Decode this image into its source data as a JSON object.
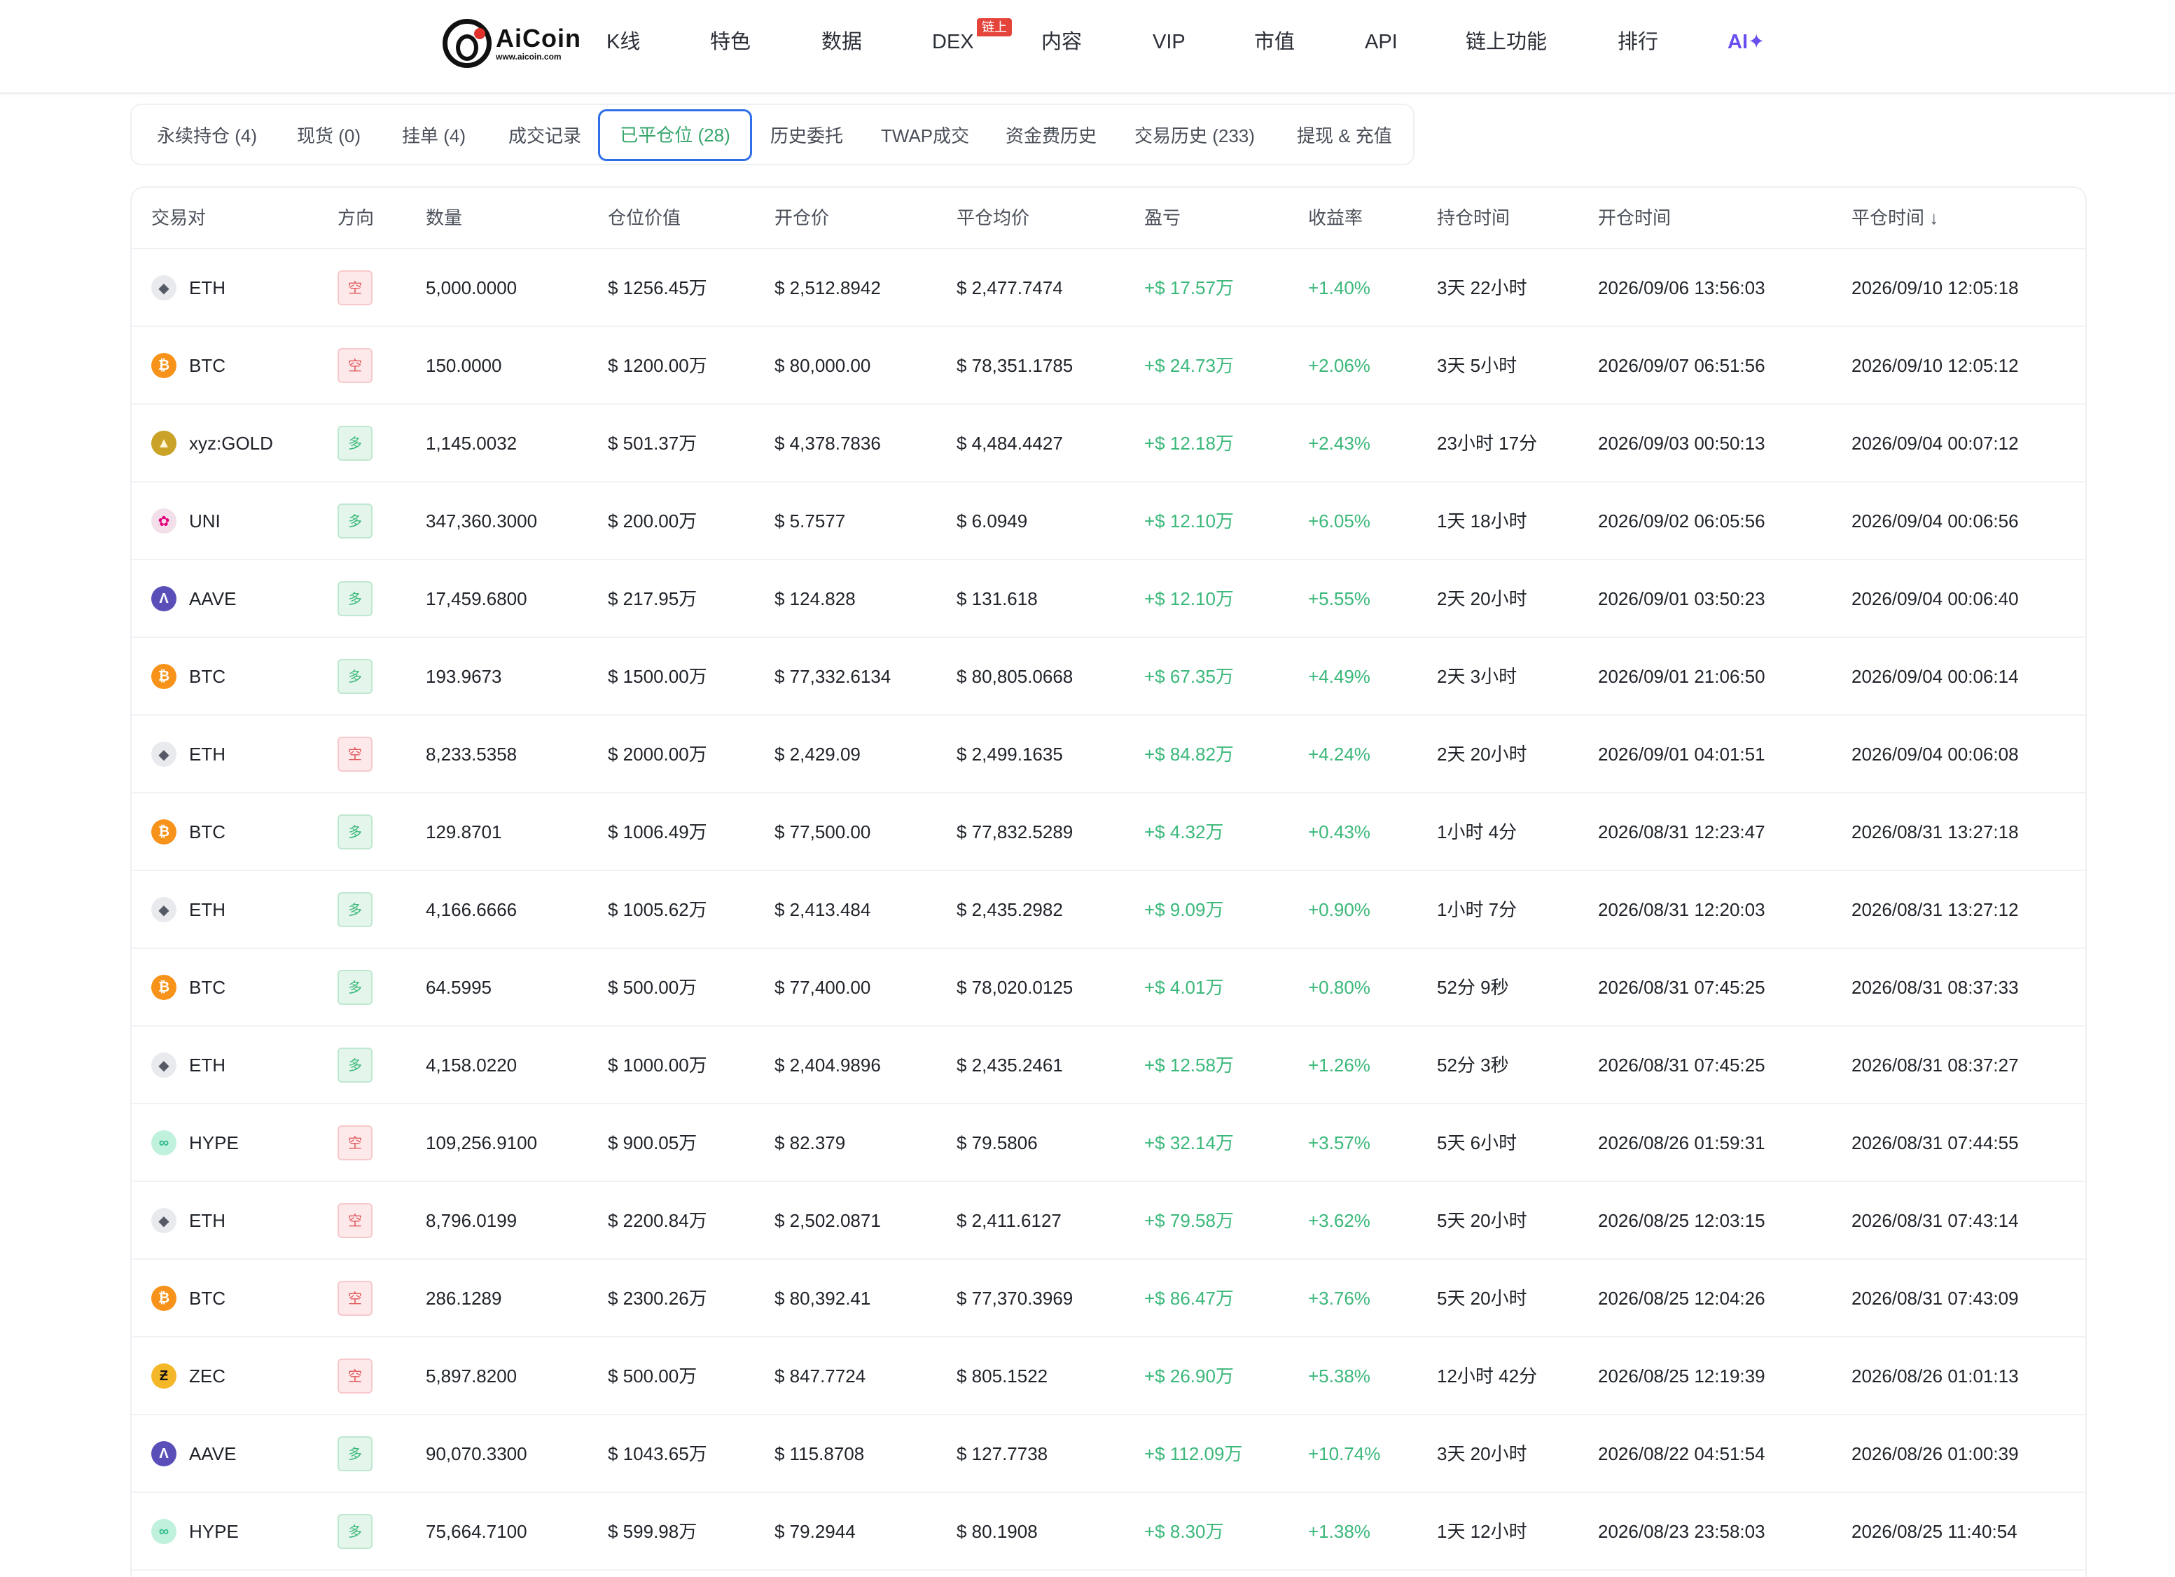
{
  "nav": {
    "logo_name": "AiCoin",
    "logo_url": "www.aicoin.com",
    "items": [
      "K线",
      "特色",
      "数据",
      "DEX",
      "内容",
      "VIP",
      "市值",
      "API",
      "链上功能",
      "排行",
      "AI✦"
    ],
    "dex_badge": "链上"
  },
  "tabs": [
    {
      "label": "永续持仓 (4)"
    },
    {
      "label": "现货 (0)"
    },
    {
      "label": "挂单 (4)"
    },
    {
      "label": "成交记录"
    },
    {
      "label": "已平仓位 (28)",
      "active": true
    },
    {
      "label": "历史委托"
    },
    {
      "label": "TWAP成交"
    },
    {
      "label": "资金费历史"
    },
    {
      "label": "交易历史 (233)"
    },
    {
      "label": "提现 & 充值"
    }
  ],
  "columns": [
    "交易对",
    "方向",
    "数量",
    "仓位价值",
    "开仓价",
    "平仓均价",
    "盈亏",
    "收益率",
    "持仓时间",
    "开仓时间",
    "平仓时间 ↓"
  ],
  "colors": {
    "profit": "#3bb87a",
    "short_bg": "#fde9ea",
    "long_bg": "#e4f6ec",
    "active_tab_border": "#2f6ee8"
  },
  "rows": [
    {
      "icon": "eth-icon",
      "pair": "ETH",
      "dir": "空",
      "qty": "5,000.0000",
      "value": "$ 1256.45万",
      "open": "$ 2,512.8942",
      "close": "$ 2,477.7474",
      "pnl": "+$ 17.57万",
      "roi": "+1.40%",
      "hold": "3天 22小时",
      "open_time": "2026/09/06 13:56:03",
      "close_time": "2026/09/10 12:05:18"
    },
    {
      "icon": "btc-icon",
      "pair": "BTC",
      "dir": "空",
      "qty": "150.0000",
      "value": "$ 1200.00万",
      "open": "$ 80,000.00",
      "close": "$ 78,351.1785",
      "pnl": "+$ 24.73万",
      "roi": "+2.06%",
      "hold": "3天 5小时",
      "open_time": "2026/09/07 06:51:56",
      "close_time": "2026/09/10 12:05:12"
    },
    {
      "icon": "gold-icon",
      "pair": "xyz:GOLD",
      "dir": "多",
      "qty": "1,145.0032",
      "value": "$ 501.37万",
      "open": "$ 4,378.7836",
      "close": "$ 4,484.4427",
      "pnl": "+$ 12.18万",
      "roi": "+2.43%",
      "hold": "23小时 17分",
      "open_time": "2026/09/03 00:50:13",
      "close_time": "2026/09/04 00:07:12"
    },
    {
      "icon": "uni-icon",
      "pair": "UNI",
      "dir": "多",
      "qty": "347,360.3000",
      "value": "$ 200.00万",
      "open": "$ 5.7577",
      "close": "$ 6.0949",
      "pnl": "+$ 12.10万",
      "roi": "+6.05%",
      "hold": "1天 18小时",
      "open_time": "2026/09/02 06:05:56",
      "close_time": "2026/09/04 00:06:56"
    },
    {
      "icon": "aave-icon",
      "pair": "AAVE",
      "dir": "多",
      "qty": "17,459.6800",
      "value": "$ 217.95万",
      "open": "$ 124.828",
      "close": "$ 131.618",
      "pnl": "+$ 12.10万",
      "roi": "+5.55%",
      "hold": "2天 20小时",
      "open_time": "2026/09/01 03:50:23",
      "close_time": "2026/09/04 00:06:40"
    },
    {
      "icon": "btc-icon",
      "pair": "BTC",
      "dir": "多",
      "qty": "193.9673",
      "value": "$ 1500.00万",
      "open": "$ 77,332.6134",
      "close": "$ 80,805.0668",
      "pnl": "+$ 67.35万",
      "roi": "+4.49%",
      "hold": "2天 3小时",
      "open_time": "2026/09/01 21:06:50",
      "close_time": "2026/09/04 00:06:14"
    },
    {
      "icon": "eth-icon",
      "pair": "ETH",
      "dir": "空",
      "qty": "8,233.5358",
      "value": "$ 2000.00万",
      "open": "$ 2,429.09",
      "close": "$ 2,499.1635",
      "pnl": "+$ 84.82万",
      "roi": "+4.24%",
      "hold": "2天 20小时",
      "open_time": "2026/09/01 04:01:51",
      "close_time": "2026/09/04 00:06:08"
    },
    {
      "icon": "btc-icon",
      "pair": "BTC",
      "dir": "多",
      "qty": "129.8701",
      "value": "$ 1006.49万",
      "open": "$ 77,500.00",
      "close": "$ 77,832.5289",
      "pnl": "+$ 4.32万",
      "roi": "+0.43%",
      "hold": "1小时 4分",
      "open_time": "2026/08/31 12:23:47",
      "close_time": "2026/08/31 13:27:18"
    },
    {
      "icon": "eth-icon",
      "pair": "ETH",
      "dir": "多",
      "qty": "4,166.6666",
      "value": "$ 1005.62万",
      "open": "$ 2,413.484",
      "close": "$ 2,435.2982",
      "pnl": "+$ 9.09万",
      "roi": "+0.90%",
      "hold": "1小时 7分",
      "open_time": "2026/08/31 12:20:03",
      "close_time": "2026/08/31 13:27:12"
    },
    {
      "icon": "btc-icon",
      "pair": "BTC",
      "dir": "多",
      "qty": "64.5995",
      "value": "$ 500.00万",
      "open": "$ 77,400.00",
      "close": "$ 78,020.0125",
      "pnl": "+$ 4.01万",
      "roi": "+0.80%",
      "hold": "52分 9秒",
      "open_time": "2026/08/31 07:45:25",
      "close_time": "2026/08/31 08:37:33"
    },
    {
      "icon": "eth-icon",
      "pair": "ETH",
      "dir": "多",
      "qty": "4,158.0220",
      "value": "$ 1000.00万",
      "open": "$ 2,404.9896",
      "close": "$ 2,435.2461",
      "pnl": "+$ 12.58万",
      "roi": "+1.26%",
      "hold": "52分 3秒",
      "open_time": "2026/08/31 07:45:25",
      "close_time": "2026/08/31 08:37:27"
    },
    {
      "icon": "hype-icon",
      "pair": "HYPE",
      "dir": "空",
      "qty": "109,256.9100",
      "value": "$ 900.05万",
      "open": "$ 82.379",
      "close": "$ 79.5806",
      "pnl": "+$ 32.14万",
      "roi": "+3.57%",
      "hold": "5天 6小时",
      "open_time": "2026/08/26 01:59:31",
      "close_time": "2026/08/31 07:44:55"
    },
    {
      "icon": "eth-icon",
      "pair": "ETH",
      "dir": "空",
      "qty": "8,796.0199",
      "value": "$ 2200.84万",
      "open": "$ 2,502.0871",
      "close": "$ 2,411.6127",
      "pnl": "+$ 79.58万",
      "roi": "+3.62%",
      "hold": "5天 20小时",
      "open_time": "2026/08/25 12:03:15",
      "close_time": "2026/08/31 07:43:14"
    },
    {
      "icon": "btc-icon",
      "pair": "BTC",
      "dir": "空",
      "qty": "286.1289",
      "value": "$ 2300.26万",
      "open": "$ 80,392.41",
      "close": "$ 77,370.3969",
      "pnl": "+$ 86.47万",
      "roi": "+3.76%",
      "hold": "5天 20小时",
      "open_time": "2026/08/25 12:04:26",
      "close_time": "2026/08/31 07:43:09"
    },
    {
      "icon": "zec-icon",
      "pair": "ZEC",
      "dir": "空",
      "qty": "5,897.8200",
      "value": "$ 500.00万",
      "open": "$ 847.7724",
      "close": "$ 805.1522",
      "pnl": "+$ 26.90万",
      "roi": "+5.38%",
      "hold": "12小时 42分",
      "open_time": "2026/08/25 12:19:39",
      "close_time": "2026/08/26 01:01:13"
    },
    {
      "icon": "aave-icon",
      "pair": "AAVE",
      "dir": "多",
      "qty": "90,070.3300",
      "value": "$ 1043.65万",
      "open": "$ 115.8708",
      "close": "$ 127.7738",
      "pnl": "+$ 112.09万",
      "roi": "+10.74%",
      "hold": "3天 20小时",
      "open_time": "2026/08/22 04:51:54",
      "close_time": "2026/08/26 01:00:39"
    },
    {
      "icon": "hype-icon",
      "pair": "HYPE",
      "dir": "多",
      "qty": "75,664.7100",
      "value": "$ 599.98万",
      "open": "$ 79.2944",
      "close": "$ 80.1908",
      "pnl": "+$ 8.30万",
      "roi": "+1.38%",
      "hold": "1天 12小时",
      "open_time": "2026/08/23 23:58:03",
      "close_time": "2026/08/25 11:40:54"
    }
  ]
}
